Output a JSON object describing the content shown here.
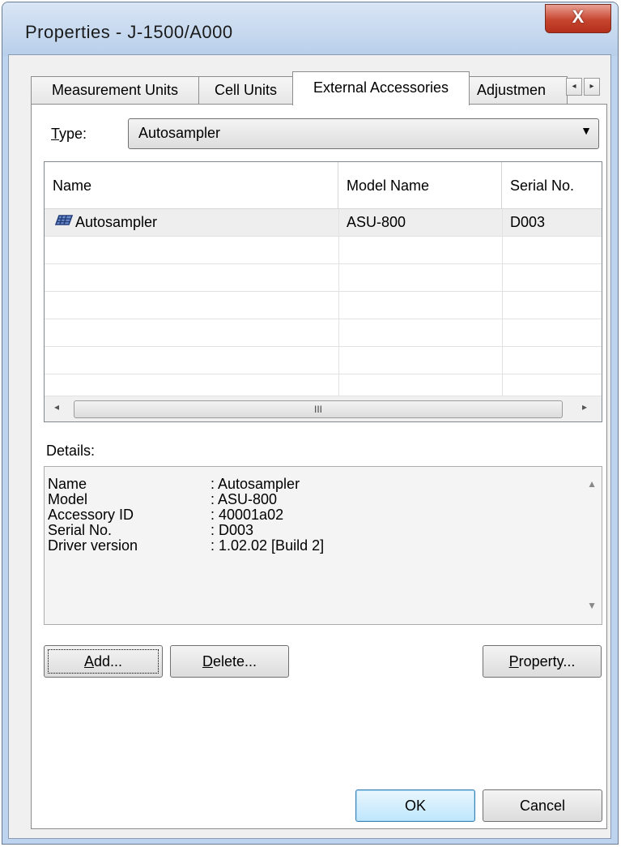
{
  "window": {
    "title": "Properties - J-1500/A000",
    "close_glyph": "X"
  },
  "tabs": [
    {
      "label": "Measurement Units"
    },
    {
      "label": "Cell Units"
    },
    {
      "label": "External Accessories"
    },
    {
      "label": "Adjustmen"
    }
  ],
  "tab_scroll": {
    "left": "◂",
    "right": "▸"
  },
  "type_field": {
    "label_prefix": "",
    "label_mnemonic": "T",
    "label_rest": "ype:",
    "value": "Autosampler",
    "arrow": "▼"
  },
  "list": {
    "columns": [
      "Name",
      "Model Name",
      "Serial No."
    ],
    "rows": [
      {
        "name": "Autosampler",
        "model": "ASU-800",
        "serial": "D003"
      }
    ],
    "scroll_left": "◂",
    "scroll_right": "▸",
    "scroll_grip": "III"
  },
  "details": {
    "label": "Details:",
    "rows": [
      {
        "key": "Name",
        "value": ": Autosampler"
      },
      {
        "key": "Model",
        "value": ": ASU-800"
      },
      {
        "key": "Accessory ID",
        "value": ": 40001a02"
      },
      {
        "key": "Serial No.",
        "value": ": D003"
      },
      {
        "key": "Driver version",
        "value": ": 1.02.02 [Build 2]"
      }
    ],
    "scroll_up": "▲",
    "scroll_down": "▼"
  },
  "buttons": {
    "add": {
      "mnemonic": "A",
      "rest": "dd..."
    },
    "delete": {
      "mnemonic": "D",
      "rest": "elete..."
    },
    "property": {
      "mnemonic": "P",
      "rest": "roperty..."
    },
    "ok": "OK",
    "cancel": "Cancel"
  }
}
